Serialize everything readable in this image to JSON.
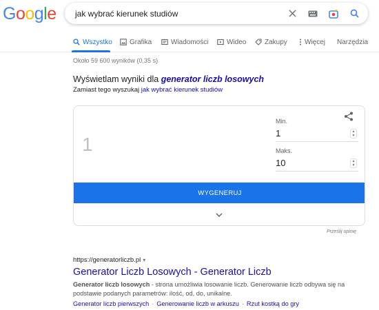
{
  "logo": {
    "text": "Google"
  },
  "search": {
    "query": "jak wybrać kierunek studiów"
  },
  "tabs": [
    {
      "label": "Wszystko",
      "icon": "search-icon",
      "active": true
    },
    {
      "label": "Grafika",
      "icon": "image-icon"
    },
    {
      "label": "Wiadomości",
      "icon": "news-icon"
    },
    {
      "label": "Wideo",
      "icon": "video-icon"
    },
    {
      "label": "Zakupy",
      "icon": "tag-icon"
    },
    {
      "label": "Więcej",
      "icon": "more-icon"
    }
  ],
  "tools_label": "Narzędzia",
  "stats": "Około 59 600 wyników (0,35 s)",
  "correction": {
    "showing_prefix": "Wyświetlam wyniki dla ",
    "showing_query": "generator liczb losowych",
    "instead_prefix": "Zamiast tego wyszukaj ",
    "instead_query": "jak wybrać kierunek studiów"
  },
  "rng": {
    "result": "1",
    "min_label": "Min.",
    "min_value": "1",
    "max_label": "Maks.",
    "max_value": "10",
    "button_label": "WYGENERUJ",
    "feedback_label": "Prześlij opinię"
  },
  "result": {
    "url": "https://generatorliczb.pl",
    "title": "Generator Liczb Losowych - Generator Liczb",
    "snippet_bold": "Generator liczb losowych",
    "snippet_rest": " - strona umożliwia losowanie liczb. Generowanie liczb odbywa się na podstawie podanych parametrów: ilość, od, do, unikalne.",
    "sitelinks": [
      "Generator liczb pierwszych",
      "Generowanie liczb w arkuszu",
      "Rzut kostką do gry"
    ]
  },
  "colors": {
    "accent": "#1a73e8",
    "link": "#1a0dab",
    "logo": [
      "#4285f4",
      "#ea4335",
      "#fbbc05",
      "#4285f4",
      "#34a853",
      "#ea4335"
    ]
  }
}
